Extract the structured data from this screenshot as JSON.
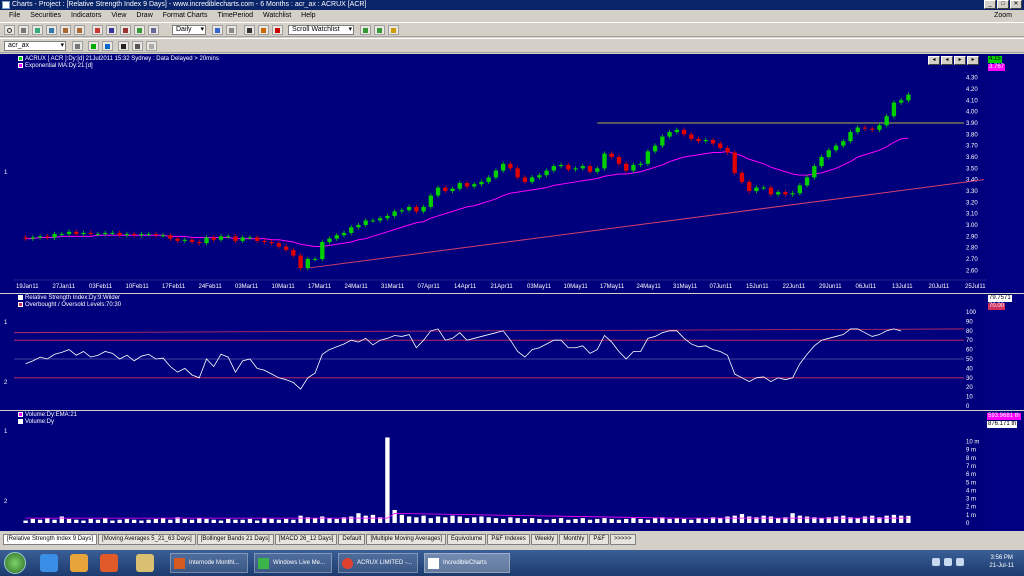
{
  "window": {
    "title": "Charts - Project : [Relative Strength Index 9 Days] - www.incrediblecharts.com - 6 Months : acr_ax : ACRUX   [ACR]",
    "controls": [
      "_",
      "□",
      "✕"
    ]
  },
  "menu": {
    "items": [
      "File",
      "Securities",
      "Indicators",
      "View",
      "Draw",
      "Format Charts",
      "TimePeriod",
      "Watchlist",
      "Help"
    ],
    "zoom_label": "Zoom"
  },
  "toolbar": {
    "period_select": "Daily",
    "watchlist_select": "Scroll Watchlist",
    "security_input": "acr_ax"
  },
  "colors": {
    "panel_bg": "#00007c",
    "up_candle": "#00d000",
    "down_candle": "#e00000",
    "ema_line": "#ff00ff",
    "trend_line": "#d04070",
    "resistance_line": "#b0b040",
    "rsi_line": "#ffffff",
    "rsi_bands": "#d03060",
    "volume_bar": "#ffffff"
  },
  "price_panel": {
    "legend": [
      "ACRUX [ ACR ]:Dy:[d]  21Jul2011 15:32 Sydney : Data Delayed > 20mins",
      "Exponential MA:Dy:21:[d]"
    ],
    "gutter_label": "1",
    "last_price_tag": "4.15",
    "ema_tag": "3.767",
    "y_ticks": [
      "4.30",
      "4.20",
      "4.10",
      "4.00",
      "3.90",
      "3.80",
      "3.70",
      "3.60",
      "3.50",
      "3.40",
      "3.30",
      "3.20",
      "3.10",
      "3.00",
      "2.90",
      "2.80",
      "2.70",
      "2.60"
    ],
    "date_labels": [
      "19Jan11",
      "27Jan11",
      "03Feb11",
      "10Feb11",
      "17Feb11",
      "24Feb11",
      "03Mar11",
      "10Mar11",
      "17Mar11",
      "24Mar11",
      "31Mar11",
      "07Apr11",
      "14Apr11",
      "21Apr11",
      "03May11",
      "10May11",
      "17May11",
      "24May11",
      "31May11",
      "07Jun11",
      "15Jun11",
      "22Jun11",
      "29Jun11",
      "06Jul11",
      "13Jul11",
      "20Jul11",
      "25Jul11"
    ]
  },
  "rsi_panel": {
    "legend": [
      "Relative Strength Index:Dy:9:Wilder",
      "Overbought / Oversold Levels:70:30"
    ],
    "gutter_labels": [
      "1",
      "2"
    ],
    "value_tag": "79.7571",
    "level_tag": "70.00",
    "y_ticks": [
      "100",
      "90",
      "80",
      "70",
      "60",
      "50",
      "40",
      "30",
      "20",
      "10",
      "0"
    ]
  },
  "volume_panel": {
    "legend": [
      "Volume:Dy:EMA:21",
      "Volume:Dy"
    ],
    "gutter_labels": [
      "1",
      "2"
    ],
    "ema_tag": "593.9681 th",
    "value_tag": "876.171 th",
    "y_ticks": [
      "10 m",
      "9 m",
      "8 m",
      "7 m",
      "6 m",
      "5 m",
      "4 m",
      "3 m",
      "2 m",
      "1 m",
      "0"
    ]
  },
  "chart_data": {
    "type": "candlestick",
    "title": "ACRUX [ ACR ]:Dy:[d]  21Jul2011 15:32 Sydney : Data Delayed > 20mins",
    "ylim": [
      2.55,
      4.35
    ],
    "price_open": [
      2.89,
      2.88,
      2.89,
      2.9,
      2.89,
      2.92,
      2.92,
      2.94,
      2.92,
      2.93,
      2.92,
      2.92,
      2.93,
      2.93,
      2.91,
      2.92,
      2.91,
      2.92,
      2.92,
      2.91,
      2.91,
      2.88,
      2.86,
      2.87,
      2.85,
      2.84,
      2.89,
      2.87,
      2.9,
      2.9,
      2.86,
      2.89,
      2.89,
      2.86,
      2.85,
      2.84,
      2.81,
      2.78,
      2.73,
      2.62,
      2.7,
      2.7,
      2.85,
      2.88,
      2.91,
      2.93,
      2.98,
      3.0,
      3.04,
      3.04,
      3.06,
      3.08,
      3.12,
      3.13,
      3.16,
      3.12,
      3.16,
      3.26,
      3.33,
      3.3,
      3.32,
      3.37,
      3.34,
      3.36,
      3.38,
      3.42,
      3.48,
      3.54,
      3.5,
      3.42,
      3.38,
      3.42,
      3.44,
      3.48,
      3.52,
      3.53,
      3.49,
      3.5,
      3.52,
      3.47,
      3.5,
      3.63,
      3.6,
      3.54,
      3.48,
      3.53,
      3.54,
      3.65,
      3.7,
      3.78,
      3.82,
      3.84,
      3.8,
      3.76,
      3.74,
      3.75,
      3.72,
      3.68,
      3.64,
      3.46,
      3.38,
      3.3,
      3.33,
      3.33,
      3.27,
      3.29,
      3.27,
      3.28,
      3.35,
      3.42,
      3.52,
      3.6,
      3.66,
      3.7,
      3.74,
      3.82,
      3.86,
      3.85,
      3.84,
      3.88,
      3.96,
      4.08,
      4.1
    ],
    "price_close": [
      2.88,
      2.89,
      2.9,
      2.89,
      2.92,
      2.92,
      2.94,
      2.92,
      2.93,
      2.92,
      2.92,
      2.93,
      2.93,
      2.91,
      2.92,
      2.91,
      2.92,
      2.92,
      2.91,
      2.91,
      2.88,
      2.86,
      2.87,
      2.85,
      2.84,
      2.89,
      2.87,
      2.9,
      2.9,
      2.86,
      2.89,
      2.89,
      2.86,
      2.85,
      2.84,
      2.81,
      2.78,
      2.73,
      2.62,
      2.7,
      2.7,
      2.85,
      2.88,
      2.91,
      2.93,
      2.98,
      3.0,
      3.04,
      3.04,
      3.06,
      3.08,
      3.12,
      3.13,
      3.16,
      3.12,
      3.16,
      3.26,
      3.33,
      3.3,
      3.32,
      3.37,
      3.34,
      3.36,
      3.38,
      3.42,
      3.48,
      3.54,
      3.5,
      3.42,
      3.38,
      3.42,
      3.44,
      3.48,
      3.52,
      3.53,
      3.49,
      3.5,
      3.52,
      3.47,
      3.5,
      3.63,
      3.6,
      3.54,
      3.48,
      3.53,
      3.54,
      3.65,
      3.7,
      3.78,
      3.82,
      3.84,
      3.8,
      3.76,
      3.74,
      3.75,
      3.72,
      3.68,
      3.64,
      3.46,
      3.38,
      3.3,
      3.33,
      3.33,
      3.27,
      3.29,
      3.27,
      3.28,
      3.35,
      3.42,
      3.52,
      3.6,
      3.66,
      3.7,
      3.74,
      3.82,
      3.86,
      3.85,
      3.84,
      3.88,
      3.96,
      4.08,
      4.1,
      4.15
    ],
    "ema": [
      2.88,
      2.88,
      2.89,
      2.89,
      2.89,
      2.9,
      2.9,
      2.9,
      2.9,
      2.9,
      2.91,
      2.91,
      2.91,
      2.91,
      2.91,
      2.91,
      2.91,
      2.91,
      2.91,
      2.91,
      2.9,
      2.9,
      2.9,
      2.89,
      2.89,
      2.89,
      2.89,
      2.89,
      2.89,
      2.88,
      2.88,
      2.88,
      2.88,
      2.88,
      2.87,
      2.87,
      2.86,
      2.85,
      2.83,
      2.82,
      2.81,
      2.81,
      2.82,
      2.83,
      2.84,
      2.85,
      2.87,
      2.88,
      2.9,
      2.92,
      2.94,
      2.96,
      2.98,
      3.0,
      3.02,
      3.03,
      3.06,
      3.08,
      3.1,
      3.12,
      3.14,
      3.16,
      3.17,
      3.19,
      3.21,
      3.23,
      3.26,
      3.28,
      3.29,
      3.3,
      3.31,
      3.32,
      3.33,
      3.35,
      3.36,
      3.37,
      3.38,
      3.39,
      3.4,
      3.41,
      3.43,
      3.44,
      3.45,
      3.45,
      3.46,
      3.47,
      3.49,
      3.51,
      3.53,
      3.56,
      3.58,
      3.6,
      3.61,
      3.62,
      3.63,
      3.64,
      3.64,
      3.65,
      3.63,
      3.61,
      3.58,
      3.56,
      3.54,
      3.51,
      3.49,
      3.47,
      3.45,
      3.44,
      3.44,
      3.45,
      3.46,
      3.48,
      3.5,
      3.53,
      3.56,
      3.6,
      3.62,
      3.64,
      3.66,
      3.69,
      3.73,
      3.76,
      3.767
    ],
    "trendline": [
      [
        39,
        2.62
      ],
      [
        121,
        3.4
      ]
    ],
    "resistance": [
      [
        79,
        3.9
      ],
      [
        121,
        3.9
      ]
    ],
    "rsi": [
      45,
      48,
      52,
      50,
      55,
      57,
      60,
      54,
      58,
      52,
      54,
      58,
      56,
      50,
      54,
      48,
      53,
      55,
      50,
      51,
      42,
      36,
      40,
      33,
      30,
      50,
      42,
      55,
      52,
      36,
      48,
      50,
      40,
      38,
      34,
      30,
      28,
      25,
      18,
      30,
      35,
      55,
      60,
      63,
      66,
      70,
      68,
      72,
      65,
      70,
      72,
      75,
      74,
      76,
      62,
      70,
      80,
      82,
      70,
      72,
      78,
      70,
      72,
      74,
      76,
      78,
      80,
      70,
      58,
      52,
      60,
      62,
      66,
      70,
      70,
      62,
      62,
      64,
      56,
      60,
      75,
      68,
      58,
      50,
      58,
      58,
      72,
      74,
      78,
      80,
      80,
      72,
      66,
      63,
      64,
      60,
      58,
      54,
      34,
      30,
      26,
      30,
      31,
      26,
      30,
      28,
      30,
      45,
      55,
      64,
      70,
      72,
      74,
      76,
      82,
      82,
      78,
      74,
      76,
      80,
      82,
      79.76
    ],
    "rsi_levels": [
      70,
      30
    ],
    "volume_m": [
      0.3,
      0.5,
      0.4,
      0.6,
      0.4,
      0.8,
      0.5,
      0.4,
      0.3,
      0.5,
      0.4,
      0.6,
      0.3,
      0.4,
      0.5,
      0.4,
      0.3,
      0.4,
      0.5,
      0.6,
      0.4,
      0.7,
      0.5,
      0.4,
      0.6,
      0.5,
      0.4,
      0.3,
      0.5,
      0.4,
      0.4,
      0.5,
      0.3,
      0.6,
      0.5,
      0.4,
      0.5,
      0.4,
      0.9,
      0.7,
      0.6,
      0.8,
      0.6,
      0.5,
      0.7,
      0.8,
      1.2,
      0.9,
      1.0,
      0.7,
      10.5,
      1.6,
      1.0,
      0.8,
      0.7,
      0.9,
      0.6,
      0.8,
      0.7,
      0.9,
      0.8,
      0.6,
      0.7,
      0.8,
      0.7,
      0.6,
      0.5,
      0.7,
      0.6,
      0.5,
      0.6,
      0.5,
      0.4,
      0.5,
      0.6,
      0.4,
      0.5,
      0.6,
      0.4,
      0.5,
      0.6,
      0.5,
      0.4,
      0.5,
      0.6,
      0.5,
      0.4,
      0.6,
      0.7,
      0.5,
      0.6,
      0.5,
      0.4,
      0.6,
      0.5,
      0.7,
      0.6,
      0.8,
      0.9,
      1.1,
      0.8,
      0.7,
      0.9,
      0.8,
      0.6,
      0.7,
      1.2,
      0.9,
      0.8,
      0.7,
      0.6,
      0.7,
      0.8,
      0.9,
      0.7,
      0.6,
      0.8,
      0.9,
      0.7,
      0.9,
      1.0,
      0.9,
      0.88
    ],
    "volume_ema_m": 0.594
  },
  "tabs": [
    "[Relative Strength Index 9 Days]",
    "[Moving Averages 5_21_63 Days]",
    "[Bollinger Bands 21 Days]",
    "[MACD 26_12 Days]",
    "Default",
    "[Multiple Moving Averages]",
    "Equivolume",
    "P&F Indexes",
    "Weekly",
    "Monthly",
    "P&F",
    ">>>>>"
  ],
  "taskbar": {
    "apps": [
      "Internode Monthl...",
      "Windows Live Me...",
      "ACRUX LIMITED -...",
      "IncredibleCharts"
    ],
    "time": "3:56 PM",
    "date": "21-Jul-11"
  }
}
